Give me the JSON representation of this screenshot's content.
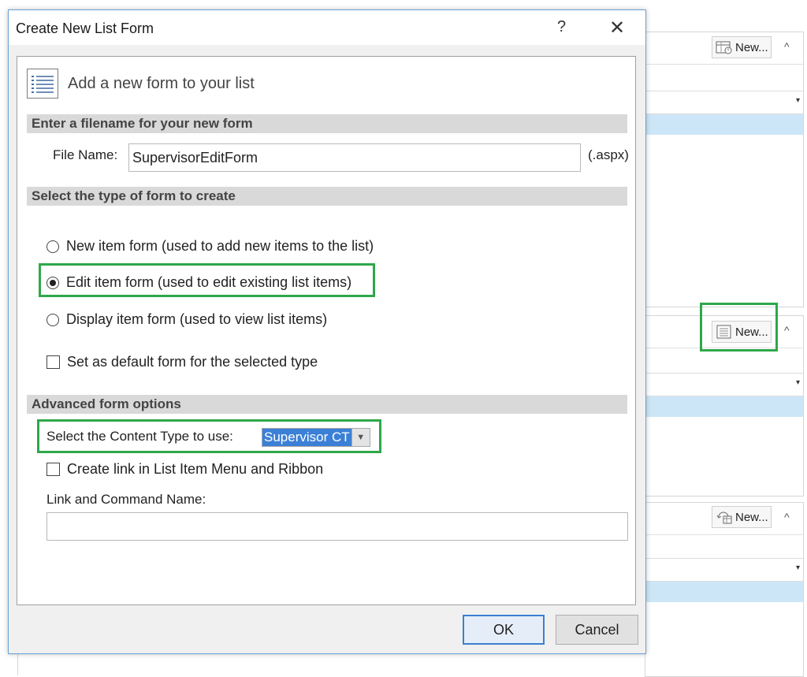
{
  "dialog": {
    "title": "Create New List Form",
    "help_glyph": "?",
    "close_glyph": "✕",
    "heading": "Add a new form to your list",
    "filename_section": {
      "header": "Enter a filename for your new form",
      "label": "File Name:",
      "value": "SupervisorEditForm",
      "extension": "(.aspx)"
    },
    "type_section": {
      "header": "Select the type of form to create",
      "options": [
        {
          "label": "New item form (used to add new items to the list)",
          "checked": false
        },
        {
          "label": "Edit item form (used to edit existing list items)",
          "checked": true
        },
        {
          "label": "Display item form (used to view list items)",
          "checked": false
        }
      ],
      "default_checkbox": "Set as default form for the selected type"
    },
    "advanced_section": {
      "header": "Advanced form options",
      "content_type_label": "Select the Content Type to use:",
      "content_type_value": "Supervisor CT",
      "link_checkbox": "Create link in List Item Menu and Ribbon",
      "link_name_label": "Link and Command Name:",
      "link_name_value": ""
    },
    "buttons": {
      "ok": "OK",
      "cancel": "Cancel"
    }
  },
  "background": {
    "panels": [
      {
        "new_label": "New...",
        "icon": "view-table-icon"
      },
      {
        "new_label": "New...",
        "icon": "form-list-icon"
      },
      {
        "new_label": "New...",
        "icon": "workflow-icon"
      }
    ],
    "collapse_glyph": "^"
  },
  "colors": {
    "highlight": "#2ea84a",
    "selection": "#3b80d6",
    "dialog_border": "#6aa1d6",
    "section_bar": "#d9d9d9"
  }
}
